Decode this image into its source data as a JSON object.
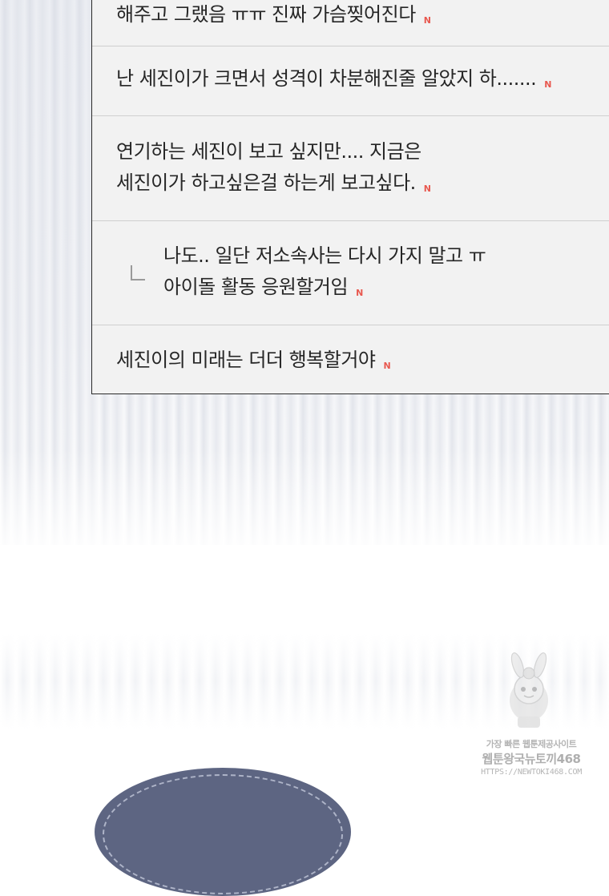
{
  "comments": [
    {
      "text": "해주고 그랬음 ㅠㅠ 진짜 가슴찢어진다",
      "badge": "N",
      "reply": false
    },
    {
      "text": "난 세진이가 크면서 성격이 차분해진줄 알았지 하.......",
      "badge": "N",
      "reply": false
    },
    {
      "text": "연기하는 세진이 보고 싶지만.... 지금은\n세진이가 하고싶은걸 하는게 보고싶다.",
      "badge": "N",
      "reply": false
    },
    {
      "text": "나도.. 일단 저소속사는 다시 가지 말고 ㅠ\n아이돌 활동 응원할거임",
      "badge": "N",
      "reply": true
    },
    {
      "text": "세진이의 미래는 더더 행복할거야",
      "badge": "N",
      "reply": false
    }
  ],
  "watermark": {
    "line1": "가장 빠른 웹툰제공사이트",
    "line2": "웹툰왕국뉴토끼468",
    "line3": "HTTPS://NEWTOKI468.COM"
  },
  "colors": {
    "badge": "#e8584f",
    "panel_bg": "#f2f2f2",
    "panel_border": "#2a2a2a",
    "bubble": "#5d6582"
  }
}
